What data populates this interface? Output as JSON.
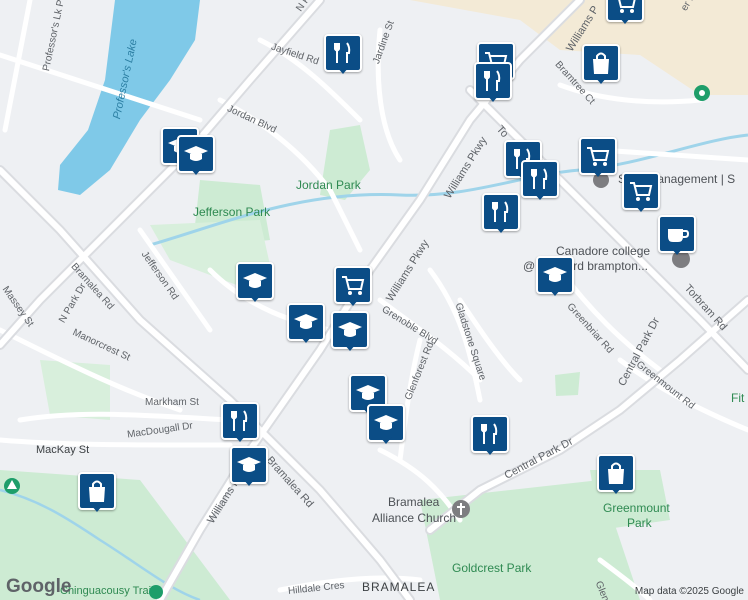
{
  "map": {
    "provider_mark": "Google",
    "attribution": "Map data ©2025 Google",
    "labels": {
      "professors_lk_pkwy": "Professor's Lk Pkwy",
      "professors_lake": "Professor's Lake",
      "n_park_dr_top": "N P",
      "jayfield_rd": "Jayfield Rd",
      "jardine_st": "Jardine St",
      "jordan_blvd": "Jordan Blvd",
      "jordan_park": "Jordan Park",
      "jefferson_park": "Jefferson Park",
      "jefferson_rd": "Jefferson Rd",
      "bramalea_rd_left": "Bramalea Rd",
      "n_park_dr": "N Park Dr",
      "massey_st": "Massey St",
      "manorcrest_st": "Manorcrest St",
      "markham_st": "Markham St",
      "macdougall_dr": "MacDougall Dr",
      "mackay_st": "MacKay St",
      "williams_pkwy_main": "Williams Pkwy",
      "williams_pkwy_mid": "Williams Pkwy",
      "williams_pkwy_top": "Williams P",
      "williams_pkwy_bottom": "Williams Pkwy",
      "bramalea_rd_bottom": "Bramalea Rd",
      "grenoble_blvd": "Grenoble Blvd",
      "glenforest_rd": "Glenforest Rd",
      "gladstone_sq": "Gladstone Square",
      "greenbriar_rd": "Greenbriar Rd",
      "central_park_dr_right": "Central Park Dr",
      "central_park_dr_bottom": "Central Park Dr",
      "greenmount_rd": "Greenmount Rd",
      "torbram_rd": "Torbram Rd",
      "torbram_top": "To",
      "bramtree_ct": "Bramtree Ct",
      "er_dr": "er Dr",
      "swift_management": "Swift Management | S",
      "canadore_line1": "Canadore college",
      "canadore_line2": "@ Stanford brampton...",
      "alliance_line1": "Bramalea",
      "alliance_line2": "Alliance Church",
      "greenmount_park_line1": "Greenmount",
      "greenmount_park_line2": "Park",
      "goldcrest_park": "Goldcrest Park",
      "bramalea_area": "BRAMALEA",
      "hilldale_cres": "Hilldale Cres",
      "chinguacousy_trail": "Chinguacousy Trail",
      "glenv": "Glenv",
      "fit": "Fit"
    },
    "markers": [
      {
        "type": "restaurant",
        "icon": "fork-knife-icon"
      },
      {
        "type": "shopping",
        "icon": "shopping-cart-icon"
      },
      {
        "type": "restaurant",
        "icon": "fork-knife-icon"
      },
      {
        "type": "store",
        "icon": "shopping-bag-icon"
      },
      {
        "type": "school",
        "icon": "graduation-cap-icon"
      },
      {
        "type": "school",
        "icon": "graduation-cap-icon"
      },
      {
        "type": "restaurant",
        "icon": "fork-knife-icon"
      },
      {
        "type": "shopping",
        "icon": "shopping-cart-icon"
      },
      {
        "type": "restaurant",
        "icon": "fork-knife-icon"
      },
      {
        "type": "shopping",
        "icon": "shopping-cart-icon"
      },
      {
        "type": "restaurant",
        "icon": "fork-knife-icon"
      },
      {
        "type": "cafe",
        "icon": "coffee-cup-icon"
      },
      {
        "type": "school",
        "icon": "graduation-cap-icon"
      },
      {
        "type": "school",
        "icon": "graduation-cap-icon"
      },
      {
        "type": "shopping",
        "icon": "shopping-cart-icon"
      },
      {
        "type": "school",
        "icon": "graduation-cap-icon"
      },
      {
        "type": "school",
        "icon": "graduation-cap-icon"
      },
      {
        "type": "school",
        "icon": "graduation-cap-icon"
      },
      {
        "type": "school",
        "icon": "graduation-cap-icon"
      },
      {
        "type": "restaurant",
        "icon": "fork-knife-icon"
      },
      {
        "type": "restaurant",
        "icon": "fork-knife-icon"
      },
      {
        "type": "school",
        "icon": "graduation-cap-icon"
      },
      {
        "type": "store",
        "icon": "shopping-bag-icon"
      },
      {
        "type": "store",
        "icon": "shopping-bag-icon"
      },
      {
        "type": "shopping",
        "icon": "shopping-cart-icon"
      }
    ],
    "colors": {
      "background": "#eef0f3",
      "road": "#ffffff",
      "major_road": "#dadce0",
      "park": "#cdebd3",
      "water": "#7fc9e8",
      "commercial": "#f3ead6",
      "marker": "#0b4d86"
    }
  }
}
